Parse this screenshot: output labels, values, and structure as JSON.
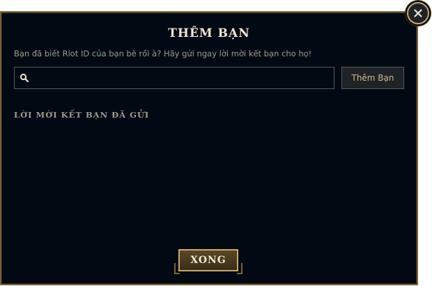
{
  "dialog": {
    "title": "THÊM BẠN",
    "subtitle": "Bạn đã biết Riot ID của bạn bè rồi à? Hãy gửi ngay lời mời kết bạn cho họ!",
    "search": {
      "value": "",
      "placeholder": "",
      "icon": "search-icon"
    },
    "add_button_label": "Thêm Bạn",
    "sent_requests_heading": "LỜI MỜI KẾT BẠN ĐÃ GỬI",
    "done_button_label": "XONG",
    "close_icon": "close-icon"
  },
  "colors": {
    "background": "#010a13",
    "gold_border": "#c8aa6e",
    "gold_dark": "#7a6233",
    "text_light": "#f0e6d2",
    "text_muted": "#a09b8c",
    "button_text": "#cdbe91"
  }
}
